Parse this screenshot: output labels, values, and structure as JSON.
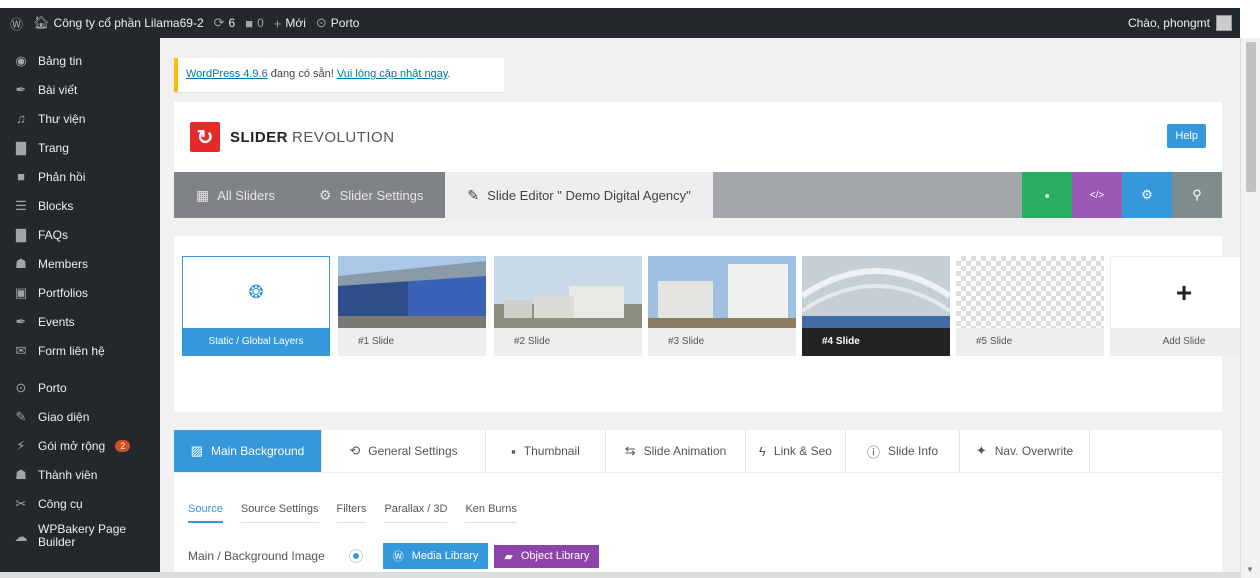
{
  "adminbar": {
    "site": "Công ty cổ phần Lilama69-2",
    "updates": "6",
    "comments": "0",
    "new": "Mới",
    "theme": "Porto",
    "greeting": "Chào, phongmt"
  },
  "sidebar": {
    "items": [
      {
        "label": "Bảng tin",
        "icon": "dashboard-icon"
      },
      {
        "label": "Bài viết",
        "icon": "pin-icon"
      },
      {
        "label": "Thư viện",
        "icon": "media-icon"
      },
      {
        "label": "Trang",
        "icon": "page-icon"
      },
      {
        "label": "Phản hồi",
        "icon": "comment-icon"
      },
      {
        "label": "Blocks",
        "icon": "blocks-icon"
      },
      {
        "label": "FAQs",
        "icon": "faq-icon"
      },
      {
        "label": "Members",
        "icon": "members-icon"
      },
      {
        "label": "Portfolios",
        "icon": "portfolio-icon"
      },
      {
        "label": "Events",
        "icon": "pin-icon"
      },
      {
        "label": "Form liên hệ",
        "icon": "mail-icon"
      },
      {
        "label": "Porto",
        "icon": "porto-icon"
      },
      {
        "label": "Giao diện",
        "icon": "appearance-icon"
      },
      {
        "label": "Gói mở rộng",
        "icon": "plugin-icon",
        "badge": "2"
      },
      {
        "label": "Thành viên",
        "icon": "users-icon"
      },
      {
        "label": "Công cụ",
        "icon": "tools-icon"
      },
      {
        "label": "WPBakery Page Builder",
        "icon": "builder-icon"
      }
    ]
  },
  "notice": {
    "link1": "WordPress 4.9.6",
    "text": " đang có sẵn! ",
    "link2": "Vui lòng cập nhật ngay",
    "end": "."
  },
  "header": {
    "brand_bold": "SLIDER",
    "brand_light": "REVOLUTION",
    "help": "Help"
  },
  "nav": {
    "all_sliders": "All Sliders",
    "slider_settings": "Slider Settings",
    "slide_editor": "Slide Editor \" Demo Digital Agency\""
  },
  "colors": {
    "accent": "#3498db",
    "save": "#27ae60",
    "code": "#9b59b6",
    "search": "#7f8c8d"
  },
  "slides": [
    {
      "label": "Static / Global Layers",
      "type": "static"
    },
    {
      "label": "#1 Slide",
      "type": "img1"
    },
    {
      "label": "#2 Slide",
      "type": "img2"
    },
    {
      "label": "#3 Slide",
      "type": "img3"
    },
    {
      "label": "#4 Slide",
      "type": "img4",
      "active": true
    },
    {
      "label": "#5 Slide",
      "type": "empty"
    },
    {
      "label": "Add Slide",
      "type": "add"
    }
  ],
  "editor_tabs": [
    {
      "label": "Main Background",
      "icon": "image-icon",
      "active": true
    },
    {
      "label": "General Settings",
      "icon": "history-icon"
    },
    {
      "label": "Thumbnail",
      "icon": "thumbnail-icon"
    },
    {
      "label": "Slide Animation",
      "icon": "animation-icon"
    },
    {
      "label": "Link & Seo",
      "icon": "bolt-icon"
    },
    {
      "label": "Slide Info",
      "icon": "info-icon"
    },
    {
      "label": "Nav. Overwrite",
      "icon": "wand-icon"
    }
  ],
  "source_tabs": [
    "Source",
    "Source Settings",
    "Filters",
    "Parallax / 3D",
    "Ken Burns"
  ],
  "bg_row": {
    "label": "Main / Background Image",
    "media_library": "Media Library",
    "object_library": "Object Library"
  }
}
